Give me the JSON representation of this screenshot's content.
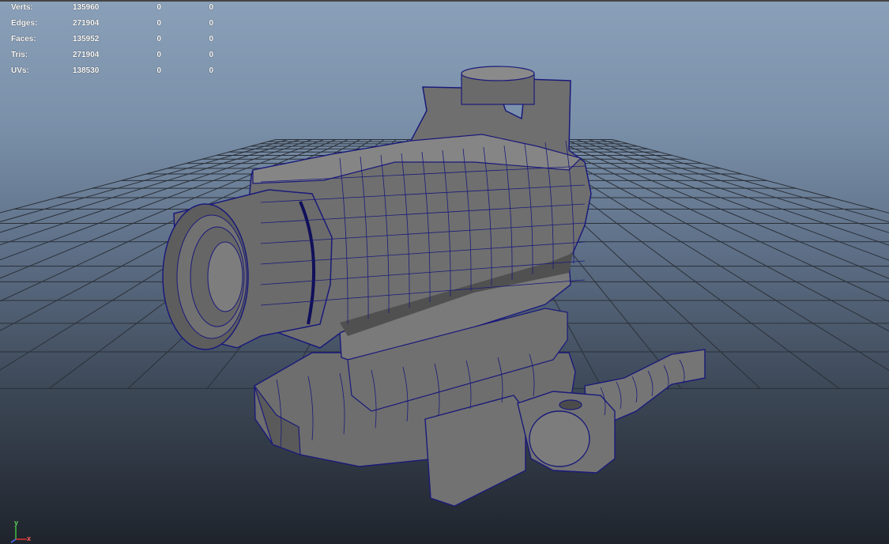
{
  "viewport": {
    "heads_up_display": {
      "rows": [
        {
          "label": "Verts:",
          "values": [
            "135960",
            "0",
            "0"
          ]
        },
        {
          "label": "Edges:",
          "values": [
            "271904",
            "0",
            "0"
          ]
        },
        {
          "label": "Faces:",
          "values": [
            "135952",
            "0",
            "0"
          ]
        },
        {
          "label": "Tris:",
          "values": [
            "271904",
            "0",
            "0"
          ]
        },
        {
          "label": "UVs:",
          "values": [
            "138530",
            "0",
            "0"
          ]
        }
      ]
    },
    "axis_gizmo": {
      "y_label": "y",
      "x_label": "x"
    },
    "colors": {
      "wireframe": "#1a1a7a",
      "grid": "#2b3038",
      "mesh": "#757575"
    }
  }
}
